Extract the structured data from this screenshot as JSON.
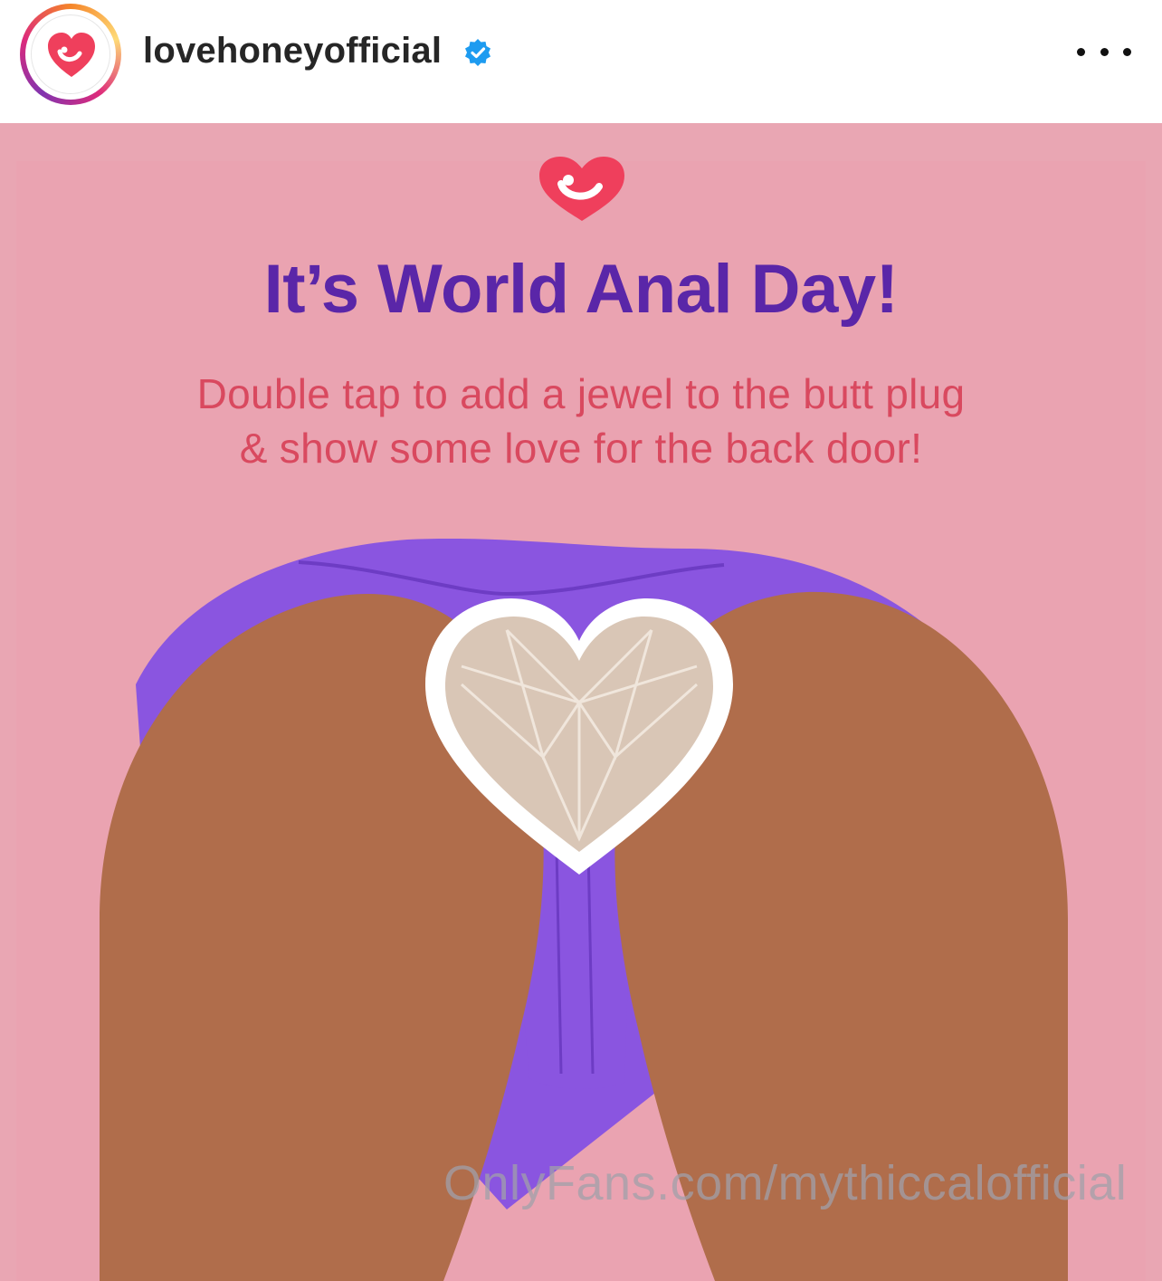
{
  "header": {
    "username": "lovehoneyofficial",
    "verified": true,
    "avatar_icon": "lovehoney-heart-logo",
    "more_icon": "more-options-icon"
  },
  "post": {
    "headline": "It’s World Anal Day!",
    "subtitle_line1": "Double tap to add a jewel to the butt plug",
    "subtitle_line2": "& show some love for the back door!",
    "watermark": "OnlyFans.com/mythiccalofficial"
  },
  "colors": {
    "background_pink": "#e9a6b3",
    "headline_purple": "#5a26a8",
    "subtitle_red": "#d9495f",
    "brand_red": "#ef3f5c",
    "underwear_purple": "#8a55e0",
    "skin": "#b06d4b",
    "jewel_beige": "#d9c6b6"
  }
}
